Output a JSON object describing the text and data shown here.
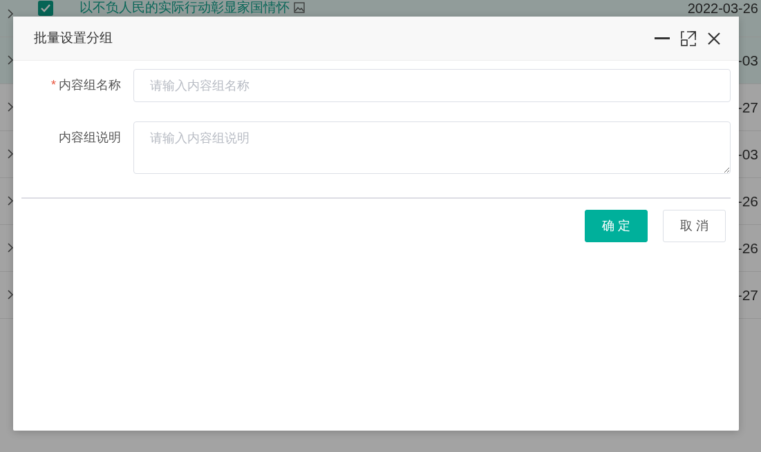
{
  "background_table": {
    "rows": [
      {
        "selected": true,
        "checked": true,
        "title": "以不负人民的实际行动彰显家国情怀",
        "date": "2022-03-26"
      },
      {
        "selected": true,
        "date": "-03"
      },
      {
        "selected": false,
        "date": "-27"
      },
      {
        "selected": false,
        "date": "-03"
      },
      {
        "selected": false,
        "date": "-26"
      },
      {
        "selected": false,
        "date": "-26"
      },
      {
        "selected": false,
        "date": "-27"
      }
    ]
  },
  "dialog": {
    "title": "批量设置分组",
    "fields": [
      {
        "kind": "input",
        "required_mark": "*",
        "label": "内容组名称",
        "placeholder": "请输入内容组名称"
      },
      {
        "kind": "textarea",
        "label": "内容组说明",
        "placeholder": "请输入内容组说明"
      }
    ],
    "buttons": [
      {
        "kind": "primary",
        "label": "确定"
      },
      {
        "kind": "default",
        "label": "取消"
      }
    ]
  }
}
